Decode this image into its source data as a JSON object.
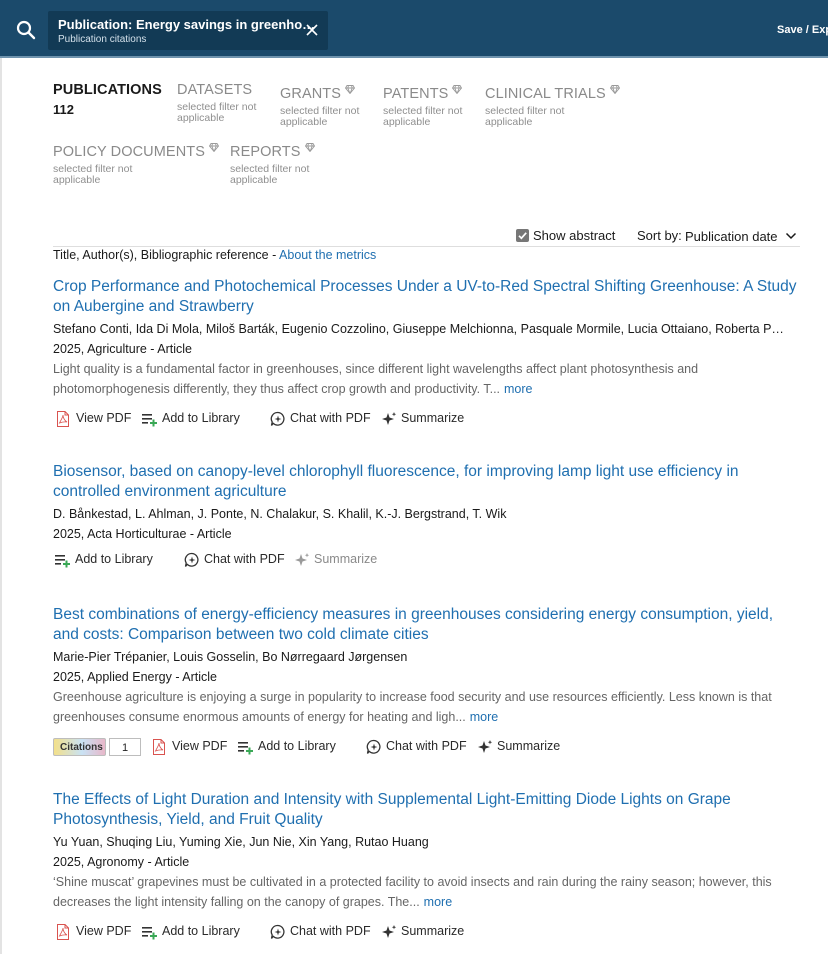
{
  "header": {
    "search_icon": "search-icon",
    "chip_title": "Publication: Energy savings in greenho…",
    "chip_subtitle": "Publication citations",
    "close_icon": "close-icon",
    "save_export": "Save / Exp"
  },
  "tabs": [
    {
      "label": "PUBLICATIONS",
      "count": "112",
      "note": "",
      "premium": false
    },
    {
      "label": "DATASETS",
      "count": "",
      "note": "selected filter not applicable",
      "premium": false
    },
    {
      "label": "GRANTS",
      "count": "",
      "note": "selected filter not applicable",
      "premium": true
    },
    {
      "label": "PATENTS",
      "count": "",
      "note": "selected filter not applicable",
      "premium": true
    },
    {
      "label": "CLINICAL TRIALS",
      "count": "",
      "note": "selected filter not applicable",
      "premium": true
    },
    {
      "label": "POLICY DOCUMENTS",
      "count": "",
      "note": "selected filter not applicable",
      "premium": true
    },
    {
      "label": "REPORTS",
      "count": "",
      "note": "selected filter not applicable",
      "premium": true
    }
  ],
  "controls": {
    "show_abstract_label": "Show abstract",
    "show_abstract_checked": true,
    "sort_label": "Sort by:",
    "sort_value": "Publication date",
    "meta_text": "Title, Author(s), Bibliographic reference - ",
    "metrics_link": "About the metrics"
  },
  "actions": {
    "view_pdf": "View PDF",
    "add_to_library": "Add to Library",
    "chat_with_pdf": "Chat with PDF",
    "summarize": "Summarize",
    "more": "more",
    "citations": "Citations"
  },
  "colors": {
    "header_bg": "#1b4a6b",
    "link": "#1f6fb0",
    "pdf_red": "#d9534f",
    "library_green": "#3aa856"
  },
  "results": [
    {
      "title": "Crop Performance and Photochemical Processes Under a UV-to-Red Spectral Shifting Greenhouse: A Study on Aubergine and Strawberry",
      "authors": "Stefano Conti, Ida Di Mola, Miloš Barták, Eugenio Cozzolino, Giuseppe Melchionna, Pasquale Mormile, Lucia Ottaiano, Roberta P…",
      "source": "2025, Agriculture - Article",
      "abstract": "Light quality is a fundamental factor in greenhouses, since different light wavelengths affect plant photosynthesis and photomorphogenesis differently, they thus affect crop growth and productivity. T...",
      "citations": ""
    },
    {
      "title": "Biosensor, based on canopy-level chlorophyll fluorescence, for improving lamp light use efficiency in controlled environment agriculture",
      "authors": "D. Bånkestad, L. Ahlman, J. Ponte, N. Chalakur, S. Khalil, K.-J. Bergstrand, T. Wik",
      "source": "2025, Acta Horticulturae - Article",
      "abstract": "",
      "citations": ""
    },
    {
      "title": "Best combinations of energy-efficiency measures in greenhouses considering energy consumption, yield, and costs: Comparison between two cold climate cities",
      "authors": "Marie-Pier Trépanier, Louis Gosselin, Bo Nørregaard Jørgensen",
      "source": "2025, Applied Energy - Article",
      "abstract": "Greenhouse agriculture is enjoying a surge in popularity to increase food security and use resources efficiently. Less known is that greenhouses consume enormous amounts of energy for heating and ligh...",
      "citations": "1"
    },
    {
      "title": "The Effects of Light Duration and Intensity with Supplemental Light-Emitting Diode Lights on Grape Photosynthesis, Yield, and Fruit Quality",
      "authors": "Yu Yuan, Shuqing Liu, Yuming Xie, Jun Nie, Xin Yang, Rutao Huang",
      "source": "2025, Agronomy - Article",
      "abstract": "‘Shine muscat’ grapevines must be cultivated in a protected facility to avoid insects and rain during the rainy season; however, this decreases the light intensity falling on the canopy of grapes. The...",
      "citations": ""
    }
  ]
}
